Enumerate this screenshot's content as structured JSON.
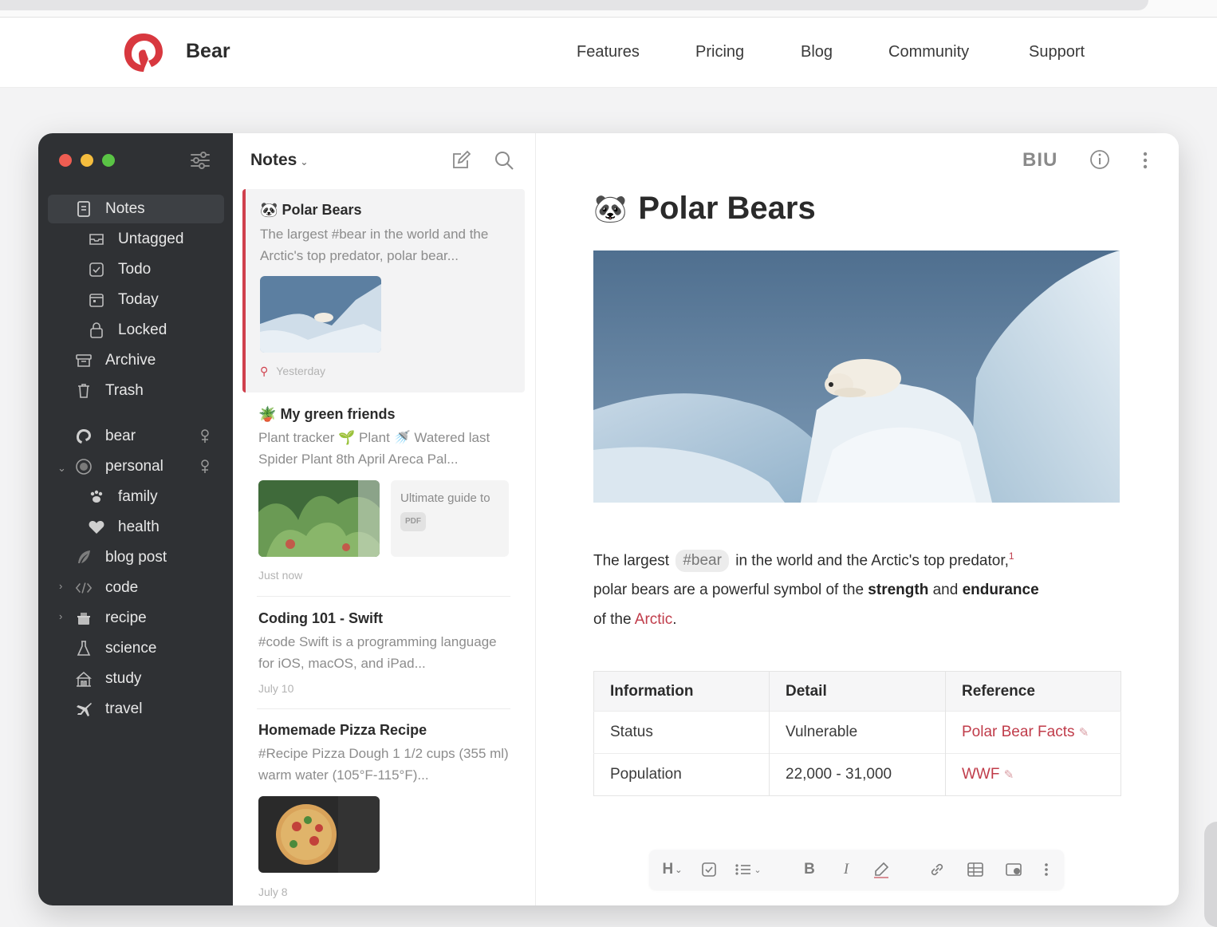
{
  "site": {
    "brand": "Bear",
    "nav": [
      "Features",
      "Pricing",
      "Blog",
      "Community",
      "Support"
    ]
  },
  "colors": {
    "accent": "#d0404d",
    "sidebar_bg": "#2f3134",
    "traffic_red": "#ee5d52",
    "traffic_yellow": "#f5bd3e",
    "traffic_green": "#5ac445"
  },
  "sidebar": {
    "items": [
      {
        "label": "Notes",
        "icon": "notes-icon"
      },
      {
        "label": "Untagged",
        "icon": "untagged-icon"
      },
      {
        "label": "Todo",
        "icon": "todo-icon"
      },
      {
        "label": "Today",
        "icon": "calendar-icon"
      },
      {
        "label": "Locked",
        "icon": "lock-icon"
      },
      {
        "label": "Archive",
        "icon": "archive-icon"
      },
      {
        "label": "Trash",
        "icon": "trash-icon"
      }
    ],
    "tags": [
      {
        "label": "bear",
        "icon": "bear-icon"
      },
      {
        "label": "personal",
        "icon": "personal-icon"
      },
      {
        "label": "family",
        "icon": "paw-icon"
      },
      {
        "label": "health",
        "icon": "heart-icon"
      },
      {
        "label": "blog post",
        "icon": "feather-icon"
      },
      {
        "label": "code",
        "icon": "code-icon"
      },
      {
        "label": "recipe",
        "icon": "recipe-icon"
      },
      {
        "label": "science",
        "icon": "flask-icon"
      },
      {
        "label": "study",
        "icon": "study-icon"
      },
      {
        "label": "travel",
        "icon": "plane-icon"
      }
    ]
  },
  "notelist": {
    "title": "Notes",
    "notes": [
      {
        "emoji": "🐼",
        "title": "Polar Bears",
        "body": "The largest #bear in the world and the Arctic's top predator, polar bear...",
        "date": "Yesterday"
      },
      {
        "emoji": "🪴",
        "title": "My green friends",
        "body": "Plant tracker 🌱 Plant 🚿 Watered last Spider Plant 8th April Areca Pal...",
        "pdf_title": "Ultimate guide to",
        "pdf_badge": "PDF",
        "date": "Just now"
      },
      {
        "title": "Coding 101 - Swift",
        "body": "#code Swift is a programming language for iOS, macOS, and iPad...",
        "date": "July 10"
      },
      {
        "title": "Homemade Pizza Recipe",
        "body": "#Recipe Pizza Dough 1 1/2 cups (355 ml) warm water (105°F-115°F)...",
        "date": "July 8"
      }
    ]
  },
  "editor": {
    "toolbar_biu": "BIU",
    "title_emoji": "🐼",
    "title": "Polar Bears",
    "para": {
      "t1": "The largest",
      "tag": "#bear",
      "t2": "in the world and the Arctic's top predator,",
      "footnote": "1",
      "t3": "polar bears are a powerful symbol of the",
      "b1": "strength",
      "t4": "and",
      "b2": "endurance",
      "t5": "of the",
      "link": "Arctic",
      "t6": "."
    },
    "table": {
      "headers": [
        "Information",
        "Detail",
        "Reference"
      ],
      "rows": [
        [
          "Status",
          "Vulnerable",
          "Polar Bear Facts"
        ],
        [
          "Population",
          "22,000 - 31,000",
          "WWF"
        ]
      ]
    },
    "format_bar": {
      "heading": "H"
    }
  }
}
